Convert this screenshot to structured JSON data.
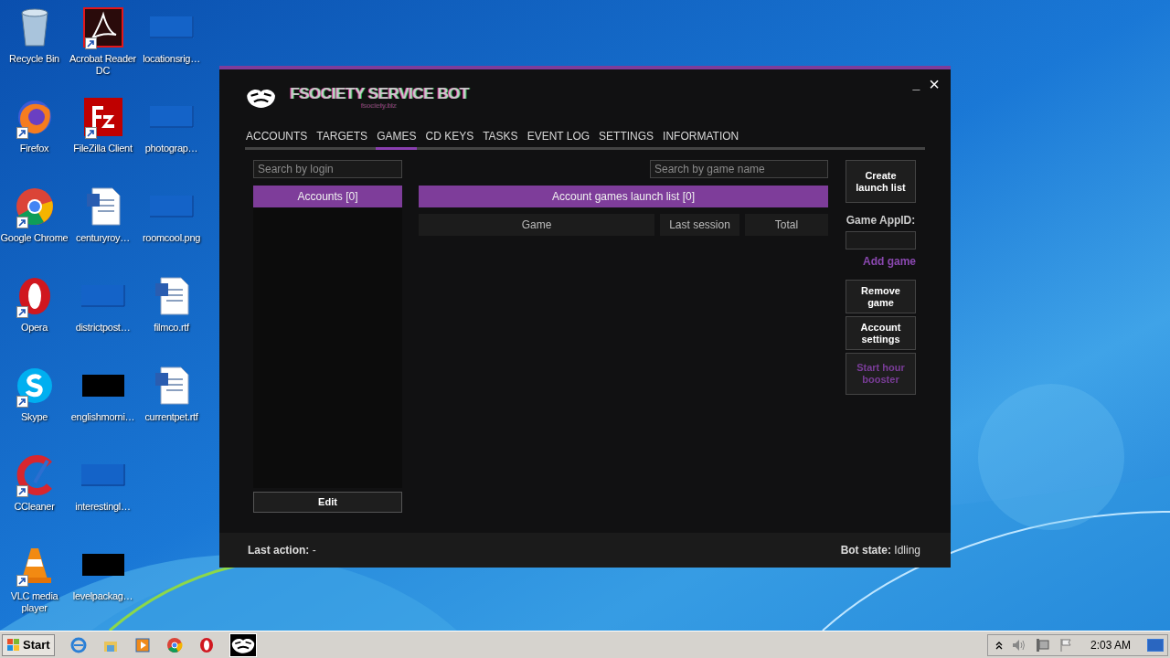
{
  "desktop_icons": [
    {
      "label": "Recycle Bin",
      "kind": "trash",
      "shortcut": false
    },
    {
      "label": "Firefox",
      "kind": "firefox",
      "shortcut": true
    },
    {
      "label": "Google Chrome",
      "kind": "chrome",
      "shortcut": true
    },
    {
      "label": "Opera",
      "kind": "opera",
      "shortcut": true
    },
    {
      "label": "Skype",
      "kind": "skype",
      "shortcut": true
    },
    {
      "label": "CCleaner",
      "kind": "ccleaner",
      "shortcut": true
    },
    {
      "label": "VLC media player",
      "kind": "vlc",
      "shortcut": true
    },
    {
      "label": "Acrobat Reader DC",
      "kind": "acrobat",
      "shortcut": true
    },
    {
      "label": "FileZilla Client",
      "kind": "filezilla",
      "shortcut": true
    },
    {
      "label": "centuryroy…",
      "kind": "word",
      "shortcut": false
    },
    {
      "label": "districtpost…",
      "kind": "blank",
      "shortcut": false
    },
    {
      "label": "englishmorni…",
      "kind": "black",
      "shortcut": false
    },
    {
      "label": "interestingl…",
      "kind": "blank",
      "shortcut": false
    },
    {
      "label": "levelpackag…",
      "kind": "black",
      "shortcut": false
    },
    {
      "label": "locationsrig…",
      "kind": "blank",
      "shortcut": false
    },
    {
      "label": "photograp…",
      "kind": "blank",
      "shortcut": false
    },
    {
      "label": "roomcool.png",
      "kind": "blank",
      "shortcut": false
    },
    {
      "label": "filmco.rtf",
      "kind": "word",
      "shortcut": false
    },
    {
      "label": "currentpet.rtf",
      "kind": "word",
      "shortcut": false
    }
  ],
  "window": {
    "title": "FSOCIETY SERVICE BOT",
    "subtitle": "fsociety.biz",
    "minimize": "_",
    "close": "×"
  },
  "tabs": [
    {
      "label": "ACCOUNTS",
      "selected": false
    },
    {
      "label": "TARGETS",
      "selected": false
    },
    {
      "label": "GAMES",
      "selected": true
    },
    {
      "label": "CD KEYS",
      "selected": false
    },
    {
      "label": "TASKS",
      "selected": false
    },
    {
      "label": "EVENT LOG",
      "selected": false
    },
    {
      "label": "SETTINGS",
      "selected": false
    },
    {
      "label": "INFORMATION",
      "selected": false
    }
  ],
  "accounts": {
    "search_placeholder": "Search by login",
    "header": "Accounts [0]",
    "edit_button": "Edit"
  },
  "games": {
    "search_placeholder": "Search by game name",
    "header": "Account games launch list [0]",
    "columns": [
      "Game",
      "Last session",
      "Total"
    ]
  },
  "side_panel": {
    "create_button": "Create launch list",
    "appid_label": "Game AppID:",
    "add_link": "Add game",
    "buttons": [
      {
        "label": "Remove game",
        "highlight": false
      },
      {
        "label": "Account settings",
        "highlight": false
      },
      {
        "label": "Start hour booster",
        "highlight": true
      }
    ]
  },
  "status_bar": {
    "last_action_label": "Last action:",
    "last_action": "-",
    "bot_state_label": "Bot state:",
    "bot_state": "Idling"
  },
  "taskbar": {
    "start": "Start",
    "apps": [
      {
        "kind": "ie",
        "active": false
      },
      {
        "kind": "folder",
        "active": false
      },
      {
        "kind": "media",
        "active": false
      },
      {
        "kind": "chrome",
        "active": false
      },
      {
        "kind": "opera",
        "active": false
      },
      {
        "kind": "mask",
        "active": true
      }
    ],
    "time": "2:03 AM"
  }
}
